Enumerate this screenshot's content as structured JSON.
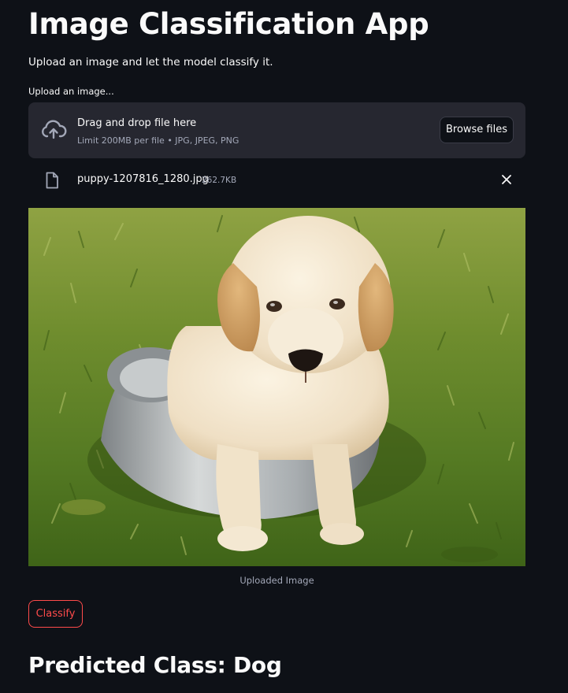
{
  "app": {
    "title": "Image Classification App",
    "subtitle": "Upload an image and let the model classify it."
  },
  "uploader": {
    "label": "Upload an image...",
    "drop_title": "Drag and drop file here",
    "limit_text": "Limit 200MB per file • JPG, JPEG, PNG",
    "browse_label": "Browse files",
    "file": {
      "name": "puppy-1207816_1280.jpg",
      "size": "262.7KB"
    }
  },
  "image": {
    "caption": "Uploaded Image"
  },
  "actions": {
    "classify_label": "Classify"
  },
  "result": {
    "text": "Predicted Class: Dog"
  },
  "icons": {
    "upload": "cloud-upload-icon",
    "file": "file-icon",
    "remove": "close-icon"
  },
  "colors": {
    "background": "#0e1117",
    "panel": "#262730",
    "text": "#fafafa",
    "muted": "#a3a8b8",
    "accent": "#ff4b4b"
  }
}
